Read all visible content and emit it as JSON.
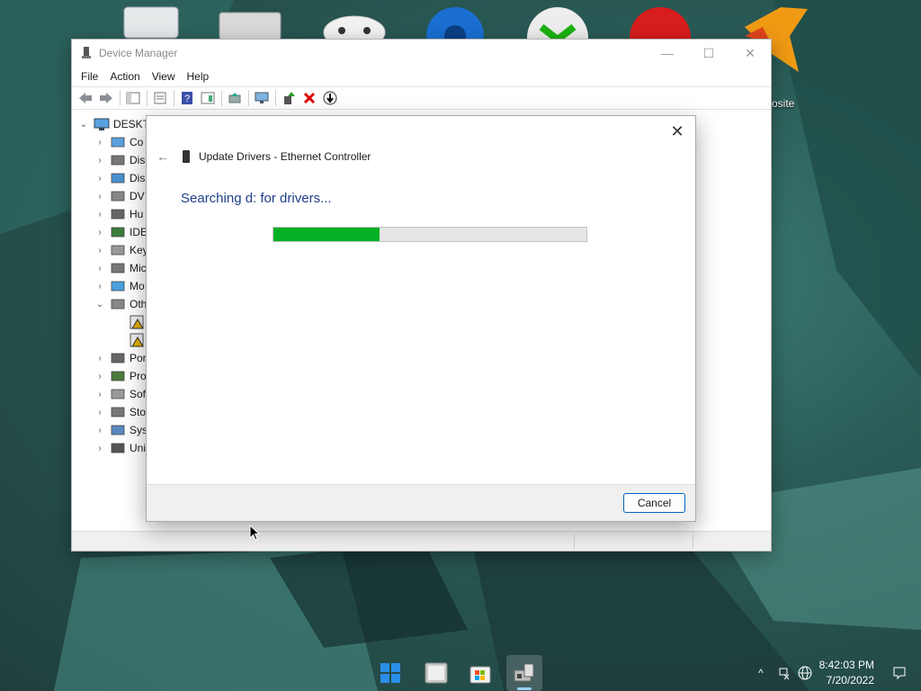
{
  "desktop": {
    "partial_label": "osite"
  },
  "device_manager": {
    "title": "Device Manager",
    "menu": [
      "File",
      "Action",
      "View",
      "Help"
    ],
    "controls": {
      "minimize": "—",
      "maximize": "☐",
      "close": "✕"
    },
    "tree": {
      "root": "DESKTO",
      "items": [
        {
          "label": "Co",
          "expander": "›",
          "icon": "computer-icon"
        },
        {
          "label": "Dis",
          "expander": "›",
          "icon": "disk-drive-icon"
        },
        {
          "label": "Dis",
          "expander": "›",
          "icon": "display-adapter-icon"
        },
        {
          "label": "DV",
          "expander": "›",
          "icon": "dvd-drive-icon"
        },
        {
          "label": "Hu",
          "expander": "›",
          "icon": "hid-icon"
        },
        {
          "label": "IDE",
          "expander": "›",
          "icon": "ide-controller-icon"
        },
        {
          "label": "Key",
          "expander": "›",
          "icon": "keyboard-icon"
        },
        {
          "label": "Mic",
          "expander": "›",
          "icon": "mouse-icon"
        },
        {
          "label": "Mo",
          "expander": "›",
          "icon": "monitor-icon"
        },
        {
          "label": "Oth",
          "expander": "⌄",
          "icon": "other-devices-icon"
        },
        {
          "label": "",
          "expander": "",
          "icon": "unknown-device-warning-icon"
        },
        {
          "label": "",
          "expander": "",
          "icon": "unknown-device-warning-icon"
        },
        {
          "label": "Por",
          "expander": "›",
          "icon": "ports-icon"
        },
        {
          "label": "Pro",
          "expander": "›",
          "icon": "processor-icon"
        },
        {
          "label": "Sof",
          "expander": "›",
          "icon": "software-device-icon"
        },
        {
          "label": "Sto",
          "expander": "›",
          "icon": "storage-controller-icon"
        },
        {
          "label": "Sys",
          "expander": "›",
          "icon": "system-device-icon"
        },
        {
          "label": "Uni",
          "expander": "›",
          "icon": "usb-controller-icon"
        }
      ]
    }
  },
  "update_dialog": {
    "close": "✕",
    "back": "←",
    "title": "Update Drivers - Ethernet Controller",
    "status_text": "Searching d: for drivers...",
    "progress_fraction": 0.34,
    "cancel_label": "Cancel"
  },
  "taskbar": {
    "apps": [
      "start-icon",
      "file-explorer-icon",
      "microsoft-store-icon",
      "device-manager-icon"
    ],
    "tray_chevron": "^",
    "time": "8:42:03 PM",
    "date": "7/20/2022"
  },
  "colors": {
    "progress_fill": "#06b025",
    "status_text": "#1f3f8a",
    "accent": "#0067c0"
  }
}
